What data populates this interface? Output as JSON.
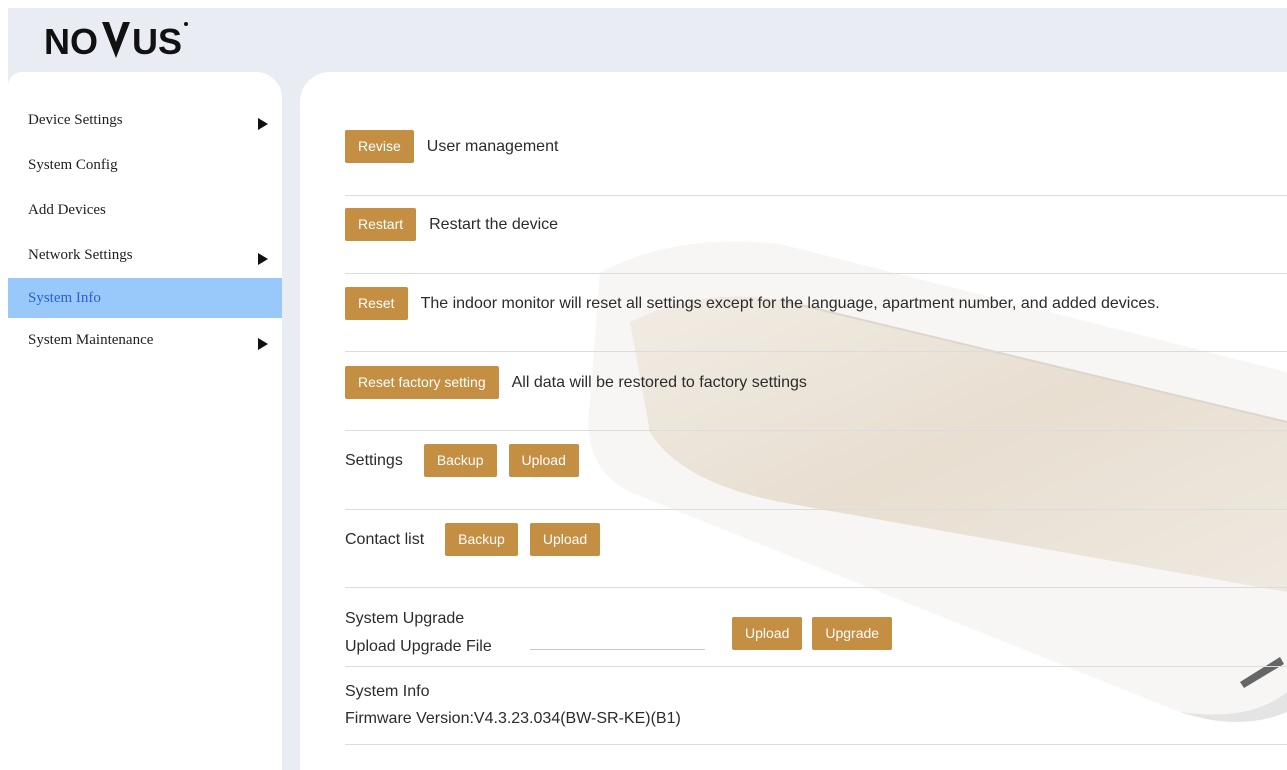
{
  "brand": {
    "logo_text": "NOVUS",
    "accent": "#c48e43",
    "active_bg": "#99c9fb"
  },
  "sidebar": {
    "items": [
      {
        "label": "Device Settings",
        "has_submenu": true
      },
      {
        "label": "System Config",
        "has_submenu": false
      },
      {
        "label": "Add Devices",
        "has_submenu": false
      },
      {
        "label": "Network Settings",
        "has_submenu": true
      },
      {
        "label": "System Info",
        "has_submenu": false,
        "active": true
      },
      {
        "label": "System Maintenance",
        "has_submenu": true
      }
    ]
  },
  "main": {
    "revise": {
      "button": "Revise",
      "text": "User management"
    },
    "restart": {
      "button": "Restart",
      "text": "Restart the device"
    },
    "reset": {
      "button": "Reset",
      "text": "The indoor monitor will reset all settings except for the language, apartment number, and added devices."
    },
    "factory": {
      "button": "Reset factory setting",
      "text": "All data will be restored to factory settings"
    },
    "settings": {
      "label": "Settings",
      "backup": "Backup",
      "upload": "Upload"
    },
    "contacts": {
      "label": "Contact list",
      "backup": "Backup",
      "upload": "Upload"
    },
    "upgrade": {
      "title": "System Upgrade",
      "file_label": "Upload Upgrade File",
      "upload": "Upload",
      "upgrade": "Upgrade"
    },
    "info": {
      "title": "System Info",
      "firmware": "Firmware Version:V4.3.23.034(BW-SR-KE)(B1)"
    }
  }
}
